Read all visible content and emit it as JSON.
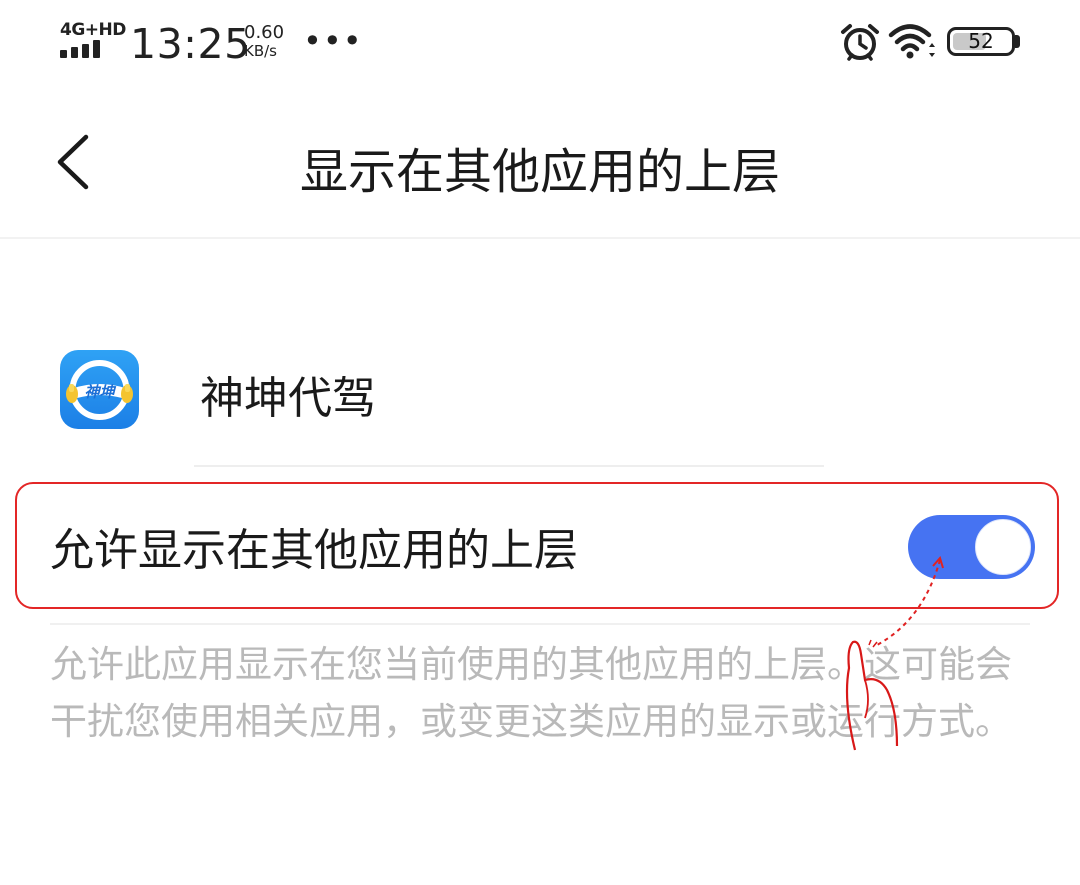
{
  "status_bar": {
    "network_type": "4G+HD",
    "time": "13:25",
    "speed_value": "0.60",
    "speed_unit": "KB/s",
    "more_indicator": "•••",
    "battery_level": "52",
    "icons": [
      "signal-icon",
      "alarm-icon",
      "wifi-icon",
      "battery-icon"
    ]
  },
  "header": {
    "title": "显示在其他应用的上层",
    "back_icon": "chevron-left-icon"
  },
  "app": {
    "name": "神坤代驾",
    "icon_text": "神坤",
    "icon": "app-logo"
  },
  "setting": {
    "label": "允许显示在其他应用的上层",
    "toggle_state": "on",
    "description": "允许此应用显示在您当前使用的其他应用的上层。这可能会干扰您使用相关应用，或变更这类应用的显示或运行方式。"
  },
  "colors": {
    "accent": "#4673f2",
    "highlight_border": "#e32626",
    "description_text": "#b9b9b9"
  }
}
